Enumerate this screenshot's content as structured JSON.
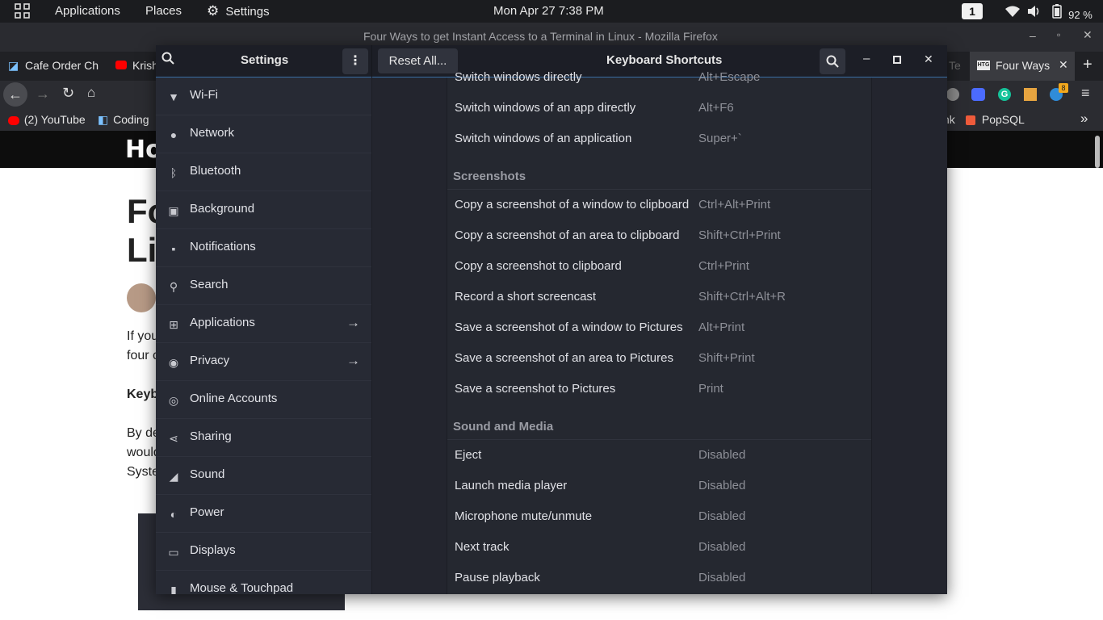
{
  "topbar": {
    "applications": "Applications",
    "places": "Places",
    "settings": "Settings",
    "clock": "Mon Apr 27   7:38 PM",
    "workspace": "1",
    "battery": "92 %"
  },
  "firefox": {
    "window_title": "Four Ways to get Instant Access to a Terminal in Linux - Mozilla Firefox",
    "tabs": [
      {
        "label": "Cafe Order Ch"
      },
      {
        "label": "Krish"
      },
      {
        "label": "Te"
      },
      {
        "label": "Four Ways"
      }
    ],
    "bookmarks": [
      {
        "label": "(2) YouTube"
      },
      {
        "label": "Coding"
      },
      {
        "label": "nk"
      },
      {
        "label": "PopSQL"
      }
    ],
    "extension_badge": "8",
    "page": {
      "logo": "Hov",
      "title_lines": [
        "Fo",
        "Li"
      ],
      "p1": [
        "If you",
        "four c"
      ],
      "bold": "Keyb",
      "p2": [
        "By de",
        "would",
        "Syste"
      ]
    }
  },
  "settings": {
    "sidebar_title": "Settings",
    "reset_label": "Reset All...",
    "panel_title": "Keyboard Shortcuts",
    "sidebar": [
      {
        "label": "Wi-Fi",
        "icon": "wifi-icon"
      },
      {
        "label": "Network",
        "icon": "network-icon"
      },
      {
        "label": "Bluetooth",
        "icon": "bluetooth-icon"
      },
      {
        "label": "Background",
        "icon": "background-icon"
      },
      {
        "label": "Notifications",
        "icon": "notifications-icon"
      },
      {
        "label": "Search",
        "icon": "search-icon"
      },
      {
        "label": "Applications",
        "icon": "applications-icon",
        "arrow": true
      },
      {
        "label": "Privacy",
        "icon": "privacy-icon",
        "arrow": true
      },
      {
        "label": "Online Accounts",
        "icon": "online-accounts-icon"
      },
      {
        "label": "Sharing",
        "icon": "sharing-icon"
      },
      {
        "label": "Sound",
        "icon": "sound-icon"
      },
      {
        "label": "Power",
        "icon": "power-icon"
      },
      {
        "label": "Displays",
        "icon": "displays-icon"
      },
      {
        "label": "Mouse & Touchpad",
        "icon": "mouse-icon"
      }
    ],
    "shortcuts": {
      "top_rows": [
        {
          "name": "Switch windows directly",
          "shortcut": "Alt+Escape"
        },
        {
          "name": "Switch windows of an app directly",
          "shortcut": "Alt+F6"
        },
        {
          "name": "Switch windows of an application",
          "shortcut": "Super+`"
        }
      ],
      "screenshots_title": "Screenshots",
      "screenshots": [
        {
          "name": "Copy a screenshot of a window to clipboard",
          "shortcut": "Ctrl+Alt+Print"
        },
        {
          "name": "Copy a screenshot of an area to clipboard",
          "shortcut": "Shift+Ctrl+Print"
        },
        {
          "name": "Copy a screenshot to clipboard",
          "shortcut": "Ctrl+Print"
        },
        {
          "name": "Record a short screencast",
          "shortcut": "Shift+Ctrl+Alt+R"
        },
        {
          "name": "Save a screenshot of a window to Pictures",
          "shortcut": "Alt+Print"
        },
        {
          "name": "Save a screenshot of an area to Pictures",
          "shortcut": "Shift+Print"
        },
        {
          "name": "Save a screenshot to Pictures",
          "shortcut": "Print"
        }
      ],
      "sound_title": "Sound and Media",
      "sound": [
        {
          "name": "Eject",
          "shortcut": "Disabled"
        },
        {
          "name": "Launch media player",
          "shortcut": "Disabled"
        },
        {
          "name": "Microphone mute/unmute",
          "shortcut": "Disabled"
        },
        {
          "name": "Next track",
          "shortcut": "Disabled"
        },
        {
          "name": "Pause playback",
          "shortcut": "Disabled"
        }
      ]
    }
  },
  "colors": {
    "accent": "#3a6ea5",
    "panel_bg": "#23252e",
    "sidebar_bg": "#272a34"
  }
}
